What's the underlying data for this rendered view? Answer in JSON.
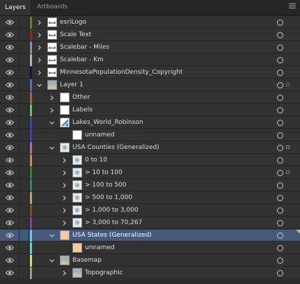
{
  "tabs": [
    {
      "label": "Layers"
    },
    {
      "label": "Artboards"
    }
  ],
  "icons": {
    "eye": "eye-icon",
    "expand_closed": "chevron-right-icon",
    "expand_open": "chevron-down-icon",
    "target": "target-circle-icon",
    "menu": "hamburger-menu-icon"
  },
  "layers": [
    {
      "name": "esriLogo",
      "color": "#7a7a12",
      "depth": 0,
      "expanded": false
    },
    {
      "name": "Scale Text",
      "color": "#b01818",
      "depth": 0,
      "expanded": false
    },
    {
      "name": "Scalebar - Miles",
      "color": "#8a8ad6",
      "depth": 0,
      "expanded": false
    },
    {
      "name": "Scalebar - Km",
      "color": "#e89ab4",
      "depth": 0,
      "expanded": false
    },
    {
      "name": "MinnesotaPopulationDensity_Copyright",
      "color": "#101070",
      "depth": 0,
      "expanded": false
    },
    {
      "name": "Layer 1",
      "color": "#4f6fd6",
      "depth": 0,
      "expanded": true,
      "selected_square": "#3f5fff"
    },
    {
      "name": "Other",
      "color": "#e04a4a",
      "depth": 1,
      "expanded": false
    },
    {
      "name": "Labels",
      "color": "#4fd64f",
      "depth": 1,
      "expanded": false
    },
    {
      "name": "Lakes_World_Robinson",
      "color": "#3a3ae0",
      "depth": 1,
      "expanded": true
    },
    {
      "name": "unnamed",
      "color": "#3a3ae0",
      "depth": 2,
      "expanded": null
    },
    {
      "name": "USA Counties (Generalized)",
      "color": "#d64fd6",
      "depth": 1,
      "expanded": true,
      "selected_square": "#e04ae0"
    },
    {
      "name": "0 to 10",
      "color": "#e08a2a",
      "depth": 2,
      "expanded": false
    },
    {
      "name": "> 10 to 100",
      "color": "#2a8a2a",
      "depth": 2,
      "expanded": false,
      "selected_square": "#2fb02f"
    },
    {
      "name": "> 100 to 500",
      "color": "#1a8a8a",
      "depth": 2,
      "expanded": false
    },
    {
      "name": "> 500 to 1,000",
      "color": "#c8a070",
      "depth": 2,
      "expanded": false
    },
    {
      "name": "> 1,000 to 3,000",
      "color": "#a03a2a",
      "depth": 2,
      "expanded": false
    },
    {
      "name": "> 3,000 to 70,267",
      "color": "#7a3ad6",
      "depth": 2,
      "expanded": false
    },
    {
      "name": "USA States (Generalized)",
      "color": "#4fd6e0",
      "depth": 1,
      "expanded": true,
      "selected": true
    },
    {
      "name": "unnamed",
      "color": "#4fd6e0",
      "depth": 2,
      "expanded": null
    },
    {
      "name": "Basemap",
      "color": "#e0e04a",
      "depth": 1,
      "expanded": true
    },
    {
      "name": "Topographic",
      "color": "#9a9a9a",
      "depth": 2,
      "expanded": false
    }
  ]
}
